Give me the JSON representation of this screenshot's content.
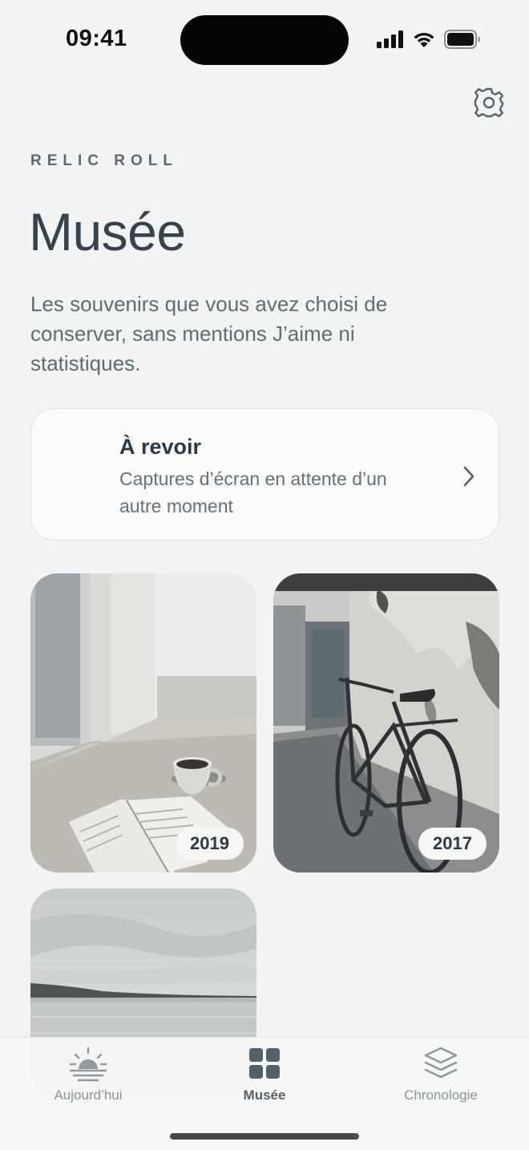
{
  "status_bar": {
    "time": "09:41"
  },
  "header": {
    "brand": "RELIC ROLL",
    "title": "Musée",
    "subtitle": "Les souvenirs que vous avez choisi de conserver, sans mentions J’aime ni statistiques."
  },
  "revisit": {
    "title": "À revoir",
    "description": "Captures d’écran en attente d’un autre moment"
  },
  "gallery": {
    "items": [
      {
        "year": "2019",
        "subject": "window-book-coffee"
      },
      {
        "year": "2017",
        "subject": "bicycle-alley"
      },
      {
        "year": "",
        "subject": "calm-sea"
      }
    ]
  },
  "tabbar": {
    "tabs": [
      {
        "label": "Aujourd’hui",
        "icon": "sunrise-icon",
        "active": false
      },
      {
        "label": "Musée",
        "icon": "grid-icon",
        "active": true
      },
      {
        "label": "Chronologie",
        "icon": "layers-icon",
        "active": false
      }
    ]
  },
  "colors": {
    "background": "#f2f4f3",
    "accent": "#526067",
    "card": "#fbfbfb"
  }
}
